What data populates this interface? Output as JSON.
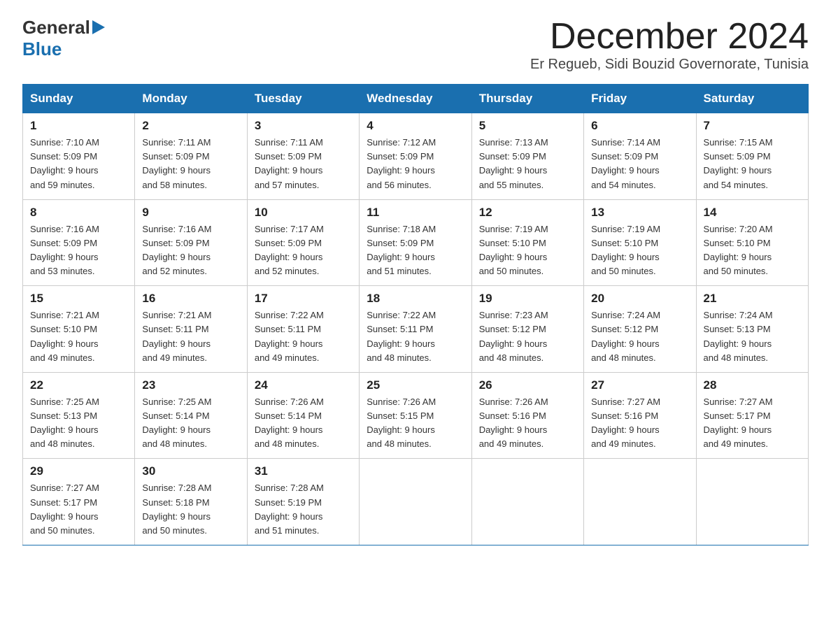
{
  "header": {
    "logo_general": "General",
    "logo_blue": "Blue",
    "month_title": "December 2024",
    "location": "Er Regueb, Sidi Bouzid Governorate, Tunisia"
  },
  "weekdays": [
    "Sunday",
    "Monday",
    "Tuesday",
    "Wednesday",
    "Thursday",
    "Friday",
    "Saturday"
  ],
  "weeks": [
    [
      {
        "day": "1",
        "sunrise": "Sunrise: 7:10 AM",
        "sunset": "Sunset: 5:09 PM",
        "daylight": "Daylight: 9 hours",
        "daylight2": "and 59 minutes."
      },
      {
        "day": "2",
        "sunrise": "Sunrise: 7:11 AM",
        "sunset": "Sunset: 5:09 PM",
        "daylight": "Daylight: 9 hours",
        "daylight2": "and 58 minutes."
      },
      {
        "day": "3",
        "sunrise": "Sunrise: 7:11 AM",
        "sunset": "Sunset: 5:09 PM",
        "daylight": "Daylight: 9 hours",
        "daylight2": "and 57 minutes."
      },
      {
        "day": "4",
        "sunrise": "Sunrise: 7:12 AM",
        "sunset": "Sunset: 5:09 PM",
        "daylight": "Daylight: 9 hours",
        "daylight2": "and 56 minutes."
      },
      {
        "day": "5",
        "sunrise": "Sunrise: 7:13 AM",
        "sunset": "Sunset: 5:09 PM",
        "daylight": "Daylight: 9 hours",
        "daylight2": "and 55 minutes."
      },
      {
        "day": "6",
        "sunrise": "Sunrise: 7:14 AM",
        "sunset": "Sunset: 5:09 PM",
        "daylight": "Daylight: 9 hours",
        "daylight2": "and 54 minutes."
      },
      {
        "day": "7",
        "sunrise": "Sunrise: 7:15 AM",
        "sunset": "Sunset: 5:09 PM",
        "daylight": "Daylight: 9 hours",
        "daylight2": "and 54 minutes."
      }
    ],
    [
      {
        "day": "8",
        "sunrise": "Sunrise: 7:16 AM",
        "sunset": "Sunset: 5:09 PM",
        "daylight": "Daylight: 9 hours",
        "daylight2": "and 53 minutes."
      },
      {
        "day": "9",
        "sunrise": "Sunrise: 7:16 AM",
        "sunset": "Sunset: 5:09 PM",
        "daylight": "Daylight: 9 hours",
        "daylight2": "and 52 minutes."
      },
      {
        "day": "10",
        "sunrise": "Sunrise: 7:17 AM",
        "sunset": "Sunset: 5:09 PM",
        "daylight": "Daylight: 9 hours",
        "daylight2": "and 52 minutes."
      },
      {
        "day": "11",
        "sunrise": "Sunrise: 7:18 AM",
        "sunset": "Sunset: 5:09 PM",
        "daylight": "Daylight: 9 hours",
        "daylight2": "and 51 minutes."
      },
      {
        "day": "12",
        "sunrise": "Sunrise: 7:19 AM",
        "sunset": "Sunset: 5:10 PM",
        "daylight": "Daylight: 9 hours",
        "daylight2": "and 50 minutes."
      },
      {
        "day": "13",
        "sunrise": "Sunrise: 7:19 AM",
        "sunset": "Sunset: 5:10 PM",
        "daylight": "Daylight: 9 hours",
        "daylight2": "and 50 minutes."
      },
      {
        "day": "14",
        "sunrise": "Sunrise: 7:20 AM",
        "sunset": "Sunset: 5:10 PM",
        "daylight": "Daylight: 9 hours",
        "daylight2": "and 50 minutes."
      }
    ],
    [
      {
        "day": "15",
        "sunrise": "Sunrise: 7:21 AM",
        "sunset": "Sunset: 5:10 PM",
        "daylight": "Daylight: 9 hours",
        "daylight2": "and 49 minutes."
      },
      {
        "day": "16",
        "sunrise": "Sunrise: 7:21 AM",
        "sunset": "Sunset: 5:11 PM",
        "daylight": "Daylight: 9 hours",
        "daylight2": "and 49 minutes."
      },
      {
        "day": "17",
        "sunrise": "Sunrise: 7:22 AM",
        "sunset": "Sunset: 5:11 PM",
        "daylight": "Daylight: 9 hours",
        "daylight2": "and 49 minutes."
      },
      {
        "day": "18",
        "sunrise": "Sunrise: 7:22 AM",
        "sunset": "Sunset: 5:11 PM",
        "daylight": "Daylight: 9 hours",
        "daylight2": "and 48 minutes."
      },
      {
        "day": "19",
        "sunrise": "Sunrise: 7:23 AM",
        "sunset": "Sunset: 5:12 PM",
        "daylight": "Daylight: 9 hours",
        "daylight2": "and 48 minutes."
      },
      {
        "day": "20",
        "sunrise": "Sunrise: 7:24 AM",
        "sunset": "Sunset: 5:12 PM",
        "daylight": "Daylight: 9 hours",
        "daylight2": "and 48 minutes."
      },
      {
        "day": "21",
        "sunrise": "Sunrise: 7:24 AM",
        "sunset": "Sunset: 5:13 PM",
        "daylight": "Daylight: 9 hours",
        "daylight2": "and 48 minutes."
      }
    ],
    [
      {
        "day": "22",
        "sunrise": "Sunrise: 7:25 AM",
        "sunset": "Sunset: 5:13 PM",
        "daylight": "Daylight: 9 hours",
        "daylight2": "and 48 minutes."
      },
      {
        "day": "23",
        "sunrise": "Sunrise: 7:25 AM",
        "sunset": "Sunset: 5:14 PM",
        "daylight": "Daylight: 9 hours",
        "daylight2": "and 48 minutes."
      },
      {
        "day": "24",
        "sunrise": "Sunrise: 7:26 AM",
        "sunset": "Sunset: 5:14 PM",
        "daylight": "Daylight: 9 hours",
        "daylight2": "and 48 minutes."
      },
      {
        "day": "25",
        "sunrise": "Sunrise: 7:26 AM",
        "sunset": "Sunset: 5:15 PM",
        "daylight": "Daylight: 9 hours",
        "daylight2": "and 48 minutes."
      },
      {
        "day": "26",
        "sunrise": "Sunrise: 7:26 AM",
        "sunset": "Sunset: 5:16 PM",
        "daylight": "Daylight: 9 hours",
        "daylight2": "and 49 minutes."
      },
      {
        "day": "27",
        "sunrise": "Sunrise: 7:27 AM",
        "sunset": "Sunset: 5:16 PM",
        "daylight": "Daylight: 9 hours",
        "daylight2": "and 49 minutes."
      },
      {
        "day": "28",
        "sunrise": "Sunrise: 7:27 AM",
        "sunset": "Sunset: 5:17 PM",
        "daylight": "Daylight: 9 hours",
        "daylight2": "and 49 minutes."
      }
    ],
    [
      {
        "day": "29",
        "sunrise": "Sunrise: 7:27 AM",
        "sunset": "Sunset: 5:17 PM",
        "daylight": "Daylight: 9 hours",
        "daylight2": "and 50 minutes."
      },
      {
        "day": "30",
        "sunrise": "Sunrise: 7:28 AM",
        "sunset": "Sunset: 5:18 PM",
        "daylight": "Daylight: 9 hours",
        "daylight2": "and 50 minutes."
      },
      {
        "day": "31",
        "sunrise": "Sunrise: 7:28 AM",
        "sunset": "Sunset: 5:19 PM",
        "daylight": "Daylight: 9 hours",
        "daylight2": "and 51 minutes."
      },
      null,
      null,
      null,
      null
    ]
  ]
}
